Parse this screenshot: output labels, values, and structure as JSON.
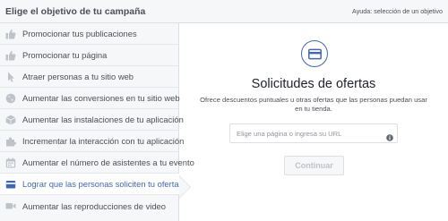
{
  "header": {
    "title": "Elige el objetivo de tu campaña",
    "help_link": "Ayuda: selección de un objetivo"
  },
  "sidebar": {
    "items": [
      {
        "label": "Promocionar tus publicaciones",
        "icon": "thumbs-up-icon",
        "active": false
      },
      {
        "label": "Promocionar tu página",
        "icon": "thumbs-up-icon",
        "active": false
      },
      {
        "label": "Atraer personas a tu sitio web",
        "icon": "cursor-icon",
        "active": false
      },
      {
        "label": "Aumentar las conversiones en tu sitio web",
        "icon": "globe-icon",
        "active": false
      },
      {
        "label": "Aumentar las instalaciones de tu aplicación",
        "icon": "box-icon",
        "active": false
      },
      {
        "label": "Incrementar la interacción con tu aplicación",
        "icon": "puzzle-icon",
        "active": false
      },
      {
        "label": "Aumentar el número de asistentes a tu evento",
        "icon": "calendar-icon",
        "active": false
      },
      {
        "label": "Lograr que las personas soliciten tu oferta",
        "icon": "offer-icon",
        "active": true
      },
      {
        "label": "Aumentar las reproducciones de video",
        "icon": "video-camera-icon",
        "active": false
      }
    ]
  },
  "main": {
    "icon": "offer-icon",
    "title": "Solicitudes de ofertas",
    "description": "Ofrece descuentos puntuales u otras ofertas que las personas puedan usar en tu tienda.",
    "input_placeholder": "Elige una página o ingresa su URL",
    "continue_label": "Continuar"
  },
  "colors": {
    "accent": "#4267b2",
    "icon_gray": "#bec3c9",
    "sidebar_bg": "#f6f7f9"
  }
}
